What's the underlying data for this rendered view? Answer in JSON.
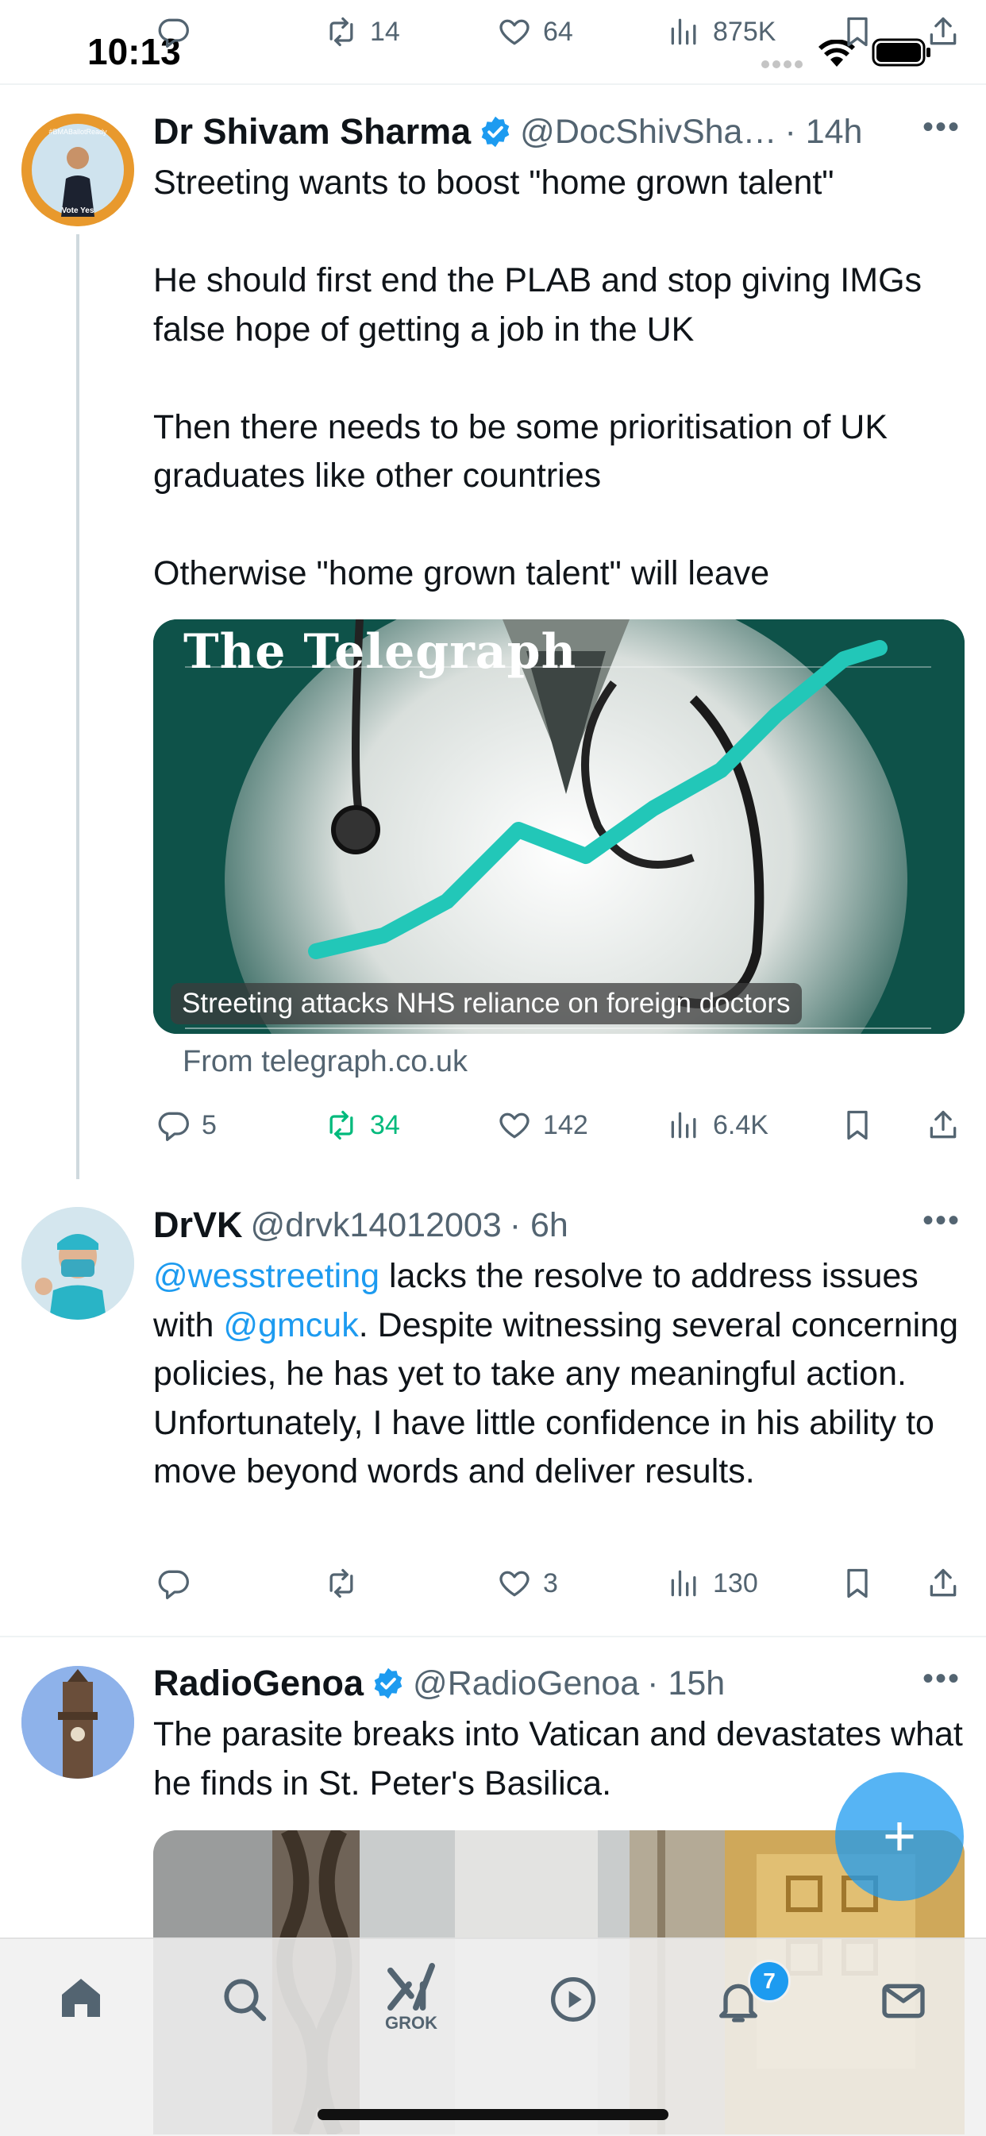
{
  "status_bar": {
    "time": "10:13"
  },
  "top_actions": {
    "replies": "",
    "retweets": "14",
    "likes": "64",
    "views": "875K"
  },
  "tweets": [
    {
      "name": "Dr Shivam Sharma",
      "handle": "@DocShivSha…",
      "time": "· 14h",
      "verified": true,
      "text": "Streeting wants to boost \"home grown talent\"\n\nHe should first end the PLAB and stop giving IMGs false hope of getting a job in the UK\n\nThen there needs to be some prioritisation of UK graduates like other countries\n\nOtherwise \"home grown talent\" will leave",
      "card": {
        "logo": "The Telegraph",
        "caption": "Streeting attacks NHS reliance on foreign doctors",
        "source": "From telegraph.co.uk"
      },
      "actions": {
        "replies": "5",
        "retweets": "34",
        "likes": "142",
        "views": "6.4K"
      }
    },
    {
      "name": "DrVK",
      "handle": "@drvk14012003",
      "time": "· 6h",
      "verified": false,
      "mention1": "@wesstreeting",
      "text_a": " lacks the resolve to address issues with ",
      "mention2": "@gmcuk",
      "text_b": ". Despite witnessing several concerning policies, he has yet to take any meaningful action. Unfortunately, I have little confidence in his ability to move beyond words and deliver results.",
      "actions": {
        "replies": "",
        "retweets": "",
        "likes": "3",
        "views": "130"
      }
    },
    {
      "name": "RadioGenoa",
      "handle": "@RadioGenoa",
      "time": "· 15h",
      "verified": true,
      "text": "The parasite breaks into Vatican and devastates what he finds in St. Peter's Basilica."
    }
  ],
  "fab": {
    "label": "+"
  },
  "tab_bar": {
    "items": [
      "home-icon",
      "search-icon",
      "grok-icon",
      "video-icon",
      "notifications-icon",
      "messages-icon"
    ],
    "grok_label": "GROK",
    "notification_count": "7"
  },
  "colors": {
    "accent": "#1d9bf0",
    "retweet_green": "#00ba7c",
    "text": "#0f1419",
    "muted": "#536471"
  }
}
